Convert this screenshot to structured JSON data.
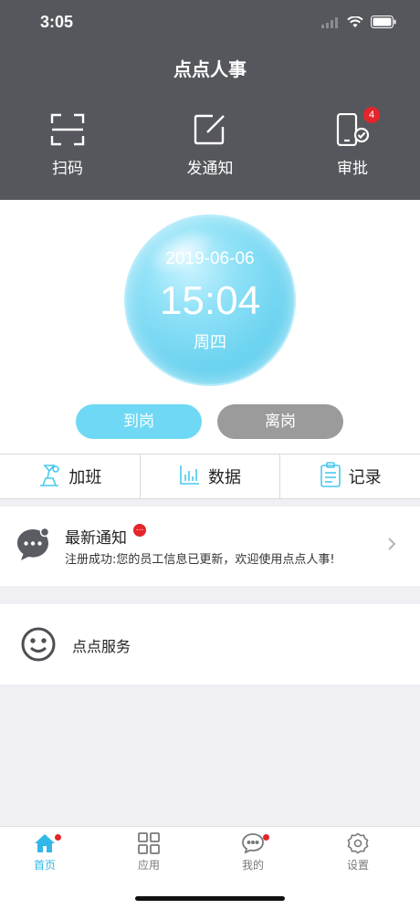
{
  "status_bar": {
    "time": "3:05"
  },
  "header": {
    "title": "点点人事",
    "actions": [
      {
        "label": "扫码",
        "icon": "scan-icon"
      },
      {
        "label": "发通知",
        "icon": "edit-icon"
      },
      {
        "label": "审批",
        "icon": "phone-check-icon",
        "badge": "4"
      }
    ]
  },
  "clock": {
    "date": "2019-06-06",
    "time": "15:04",
    "weekday": "周四"
  },
  "attendance": {
    "on_duty": "到岗",
    "off_duty": "离岗"
  },
  "quick_tabs": [
    {
      "label": "加班",
      "icon": "overtime-icon"
    },
    {
      "label": "数据",
      "icon": "chart-icon"
    },
    {
      "label": "记录",
      "icon": "clipboard-icon"
    }
  ],
  "notice": {
    "title": "最新通知",
    "badge": "...",
    "text": "注册成功:您的员工信息已更新，欢迎使用点点人事!"
  },
  "service": {
    "label": "点点服务"
  },
  "tabbar": [
    {
      "label": "首页",
      "icon": "home-icon",
      "active": true
    },
    {
      "label": "应用",
      "icon": "grid-icon",
      "active": false
    },
    {
      "label": "我的",
      "icon": "chat-icon",
      "active": false
    },
    {
      "label": "设置",
      "icon": "settings-icon",
      "active": false
    }
  ],
  "colors": {
    "header_bg": "#55575c",
    "accent": "#31b8e8",
    "bubble": "#6cd3f0",
    "badge": "#e5252b",
    "off_button": "#9b9b9b"
  }
}
